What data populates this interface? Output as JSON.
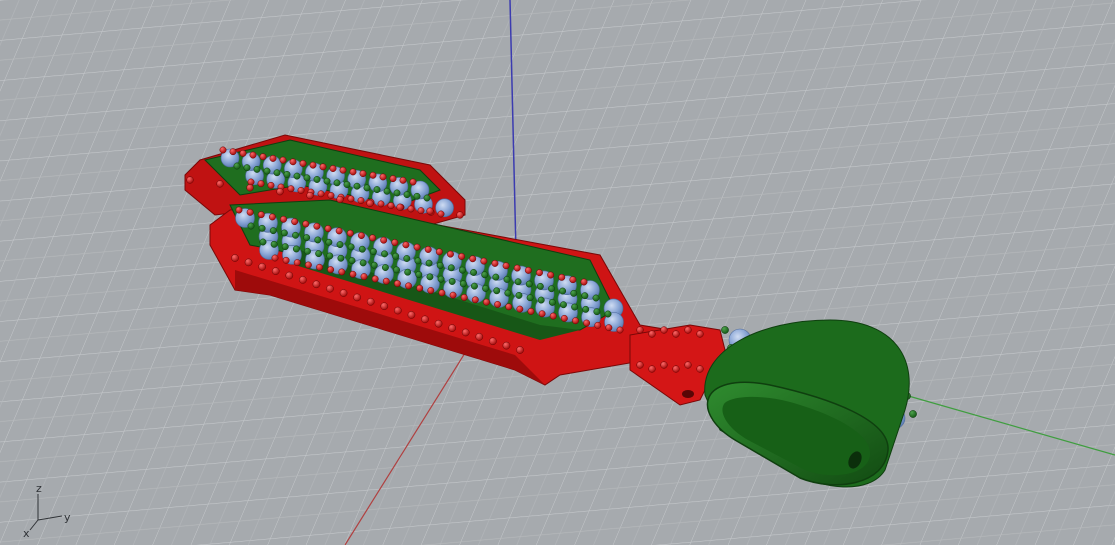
{
  "viewport": {
    "background": "#a6aaae",
    "grid_color": "#c8cbce",
    "grid_major_color": "#b7babd",
    "axes": {
      "x_axis_color": "#b04040",
      "y_axis_color": "#3f9e3f",
      "z_axis_color": "#3b3bb0"
    }
  },
  "model": {
    "name": "jewelry-pendant",
    "metal_color": "#d41616",
    "prong_color": "#1c6b1c",
    "gem_color": "#8ea9d6",
    "bail_color": "#1f6e1f"
  },
  "axis_triad": {
    "z_label": "z",
    "y_label": "y",
    "x_label": "x"
  }
}
